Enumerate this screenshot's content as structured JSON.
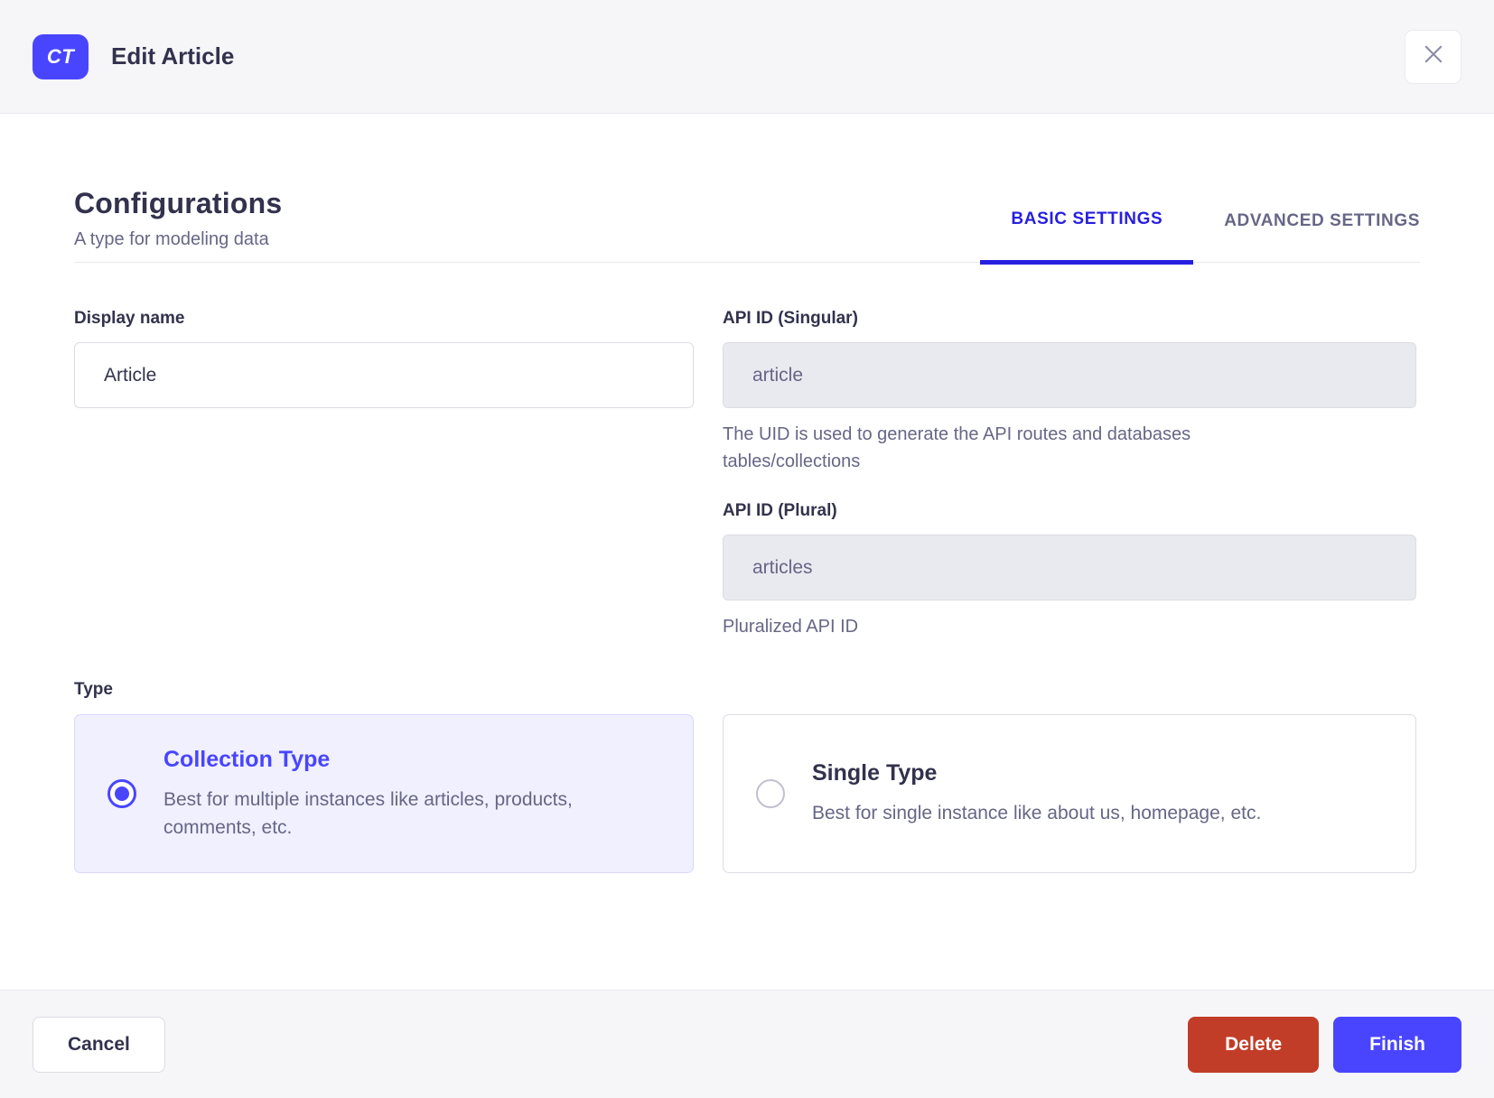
{
  "header": {
    "badge": "CT",
    "title": "Edit Article"
  },
  "config": {
    "title": "Configurations",
    "subtitle": "A type for modeling data",
    "tabs": [
      {
        "label": "BASIC SETTINGS",
        "active": true
      },
      {
        "label": "ADVANCED SETTINGS",
        "active": false
      }
    ]
  },
  "form": {
    "display_name": {
      "label": "Display name",
      "value": "Article"
    },
    "api_id_singular": {
      "label": "API ID (Singular)",
      "value": "article",
      "helper": "The UID is used to generate the API routes and databases tables/collections"
    },
    "api_id_plural": {
      "label": "API ID (Plural)",
      "value": "articles",
      "helper": "Pluralized API ID"
    },
    "type": {
      "label": "Type",
      "options": [
        {
          "title": "Collection Type",
          "description": "Best for multiple instances like articles, products, comments, etc.",
          "selected": true
        },
        {
          "title": "Single Type",
          "description": "Best for single instance like about us, homepage, etc.",
          "selected": false
        }
      ]
    }
  },
  "footer": {
    "cancel_label": "Cancel",
    "delete_label": "Delete",
    "finish_label": "Finish"
  },
  "colors": {
    "primary": "#4945ff",
    "tab_active": "#271fe0",
    "danger": "#c23d28",
    "text_dark": "#32324d",
    "text_muted": "#666687",
    "header_bg": "#f6f6f9",
    "disabled_bg": "#e9e9f0",
    "selected_card_bg": "#f0f0ff"
  }
}
